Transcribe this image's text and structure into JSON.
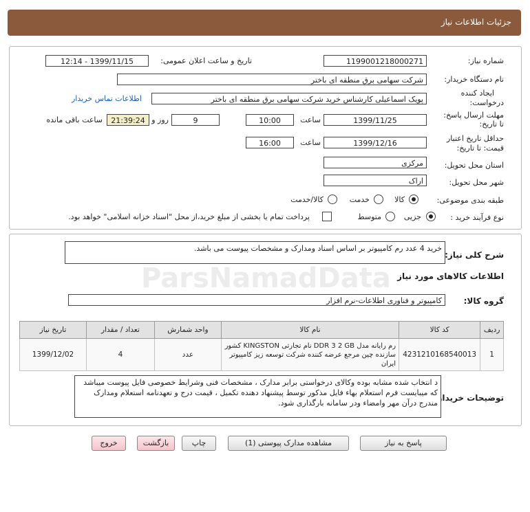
{
  "header": {
    "title": "جزئیات اطلاعات نیاز"
  },
  "fields": {
    "need_number_label": "شماره نیاز:",
    "need_number": "1199001218000271",
    "announce_label": "تاریخ و ساعت اعلان عمومی:",
    "announce_value": "1399/11/15 - 12:14",
    "buyer_org_label": "نام دستگاه خریدار:",
    "buyer_org": "شرکت سهامی برق منطقه ای باختر",
    "creator_label_1": "ایجاد کننده",
    "creator_label_2": "درخواست:",
    "creator": "پویک اسماعیلی کارشناس خرید شرکت سهامی برق منطقه ای باختر",
    "contact_link": "اطلاعات تماس خریدار",
    "deadline_label_1": "مهلت ارسال پاسخ:",
    "deadline_label_2": "تا تاریخ:",
    "deadline_date": "1399/11/25",
    "time_label": "ساعت",
    "deadline_time": "10:00",
    "days_value": "9",
    "days_label": "روز و",
    "remaining_time": "21:39:24",
    "remaining_label": "ساعت باقی مانده",
    "validity_label_1": "حداقل تاریخ اعتبار",
    "validity_label_2": "قیمت: تا تاریخ:",
    "validity_date": "1399/12/16",
    "validity_time": "16:00",
    "province_label": "استان محل تحویل:",
    "province": "مرکزی",
    "city_label": "شهر محل تحویل:",
    "city": "اراک",
    "category_label": "طبقه بندی موضوعی:",
    "category_options": [
      "کالا",
      "خدمت",
      "کالا/خدمت"
    ],
    "process_label": "نوع فرآیند خرید :",
    "process_options": [
      "جزیی",
      "متوسط"
    ],
    "payment_note": "پرداخت تمام یا بخشی از مبلغ خرید،از محل \"اسناد خزانه اسلامی\" خواهد بود."
  },
  "summary": {
    "label": "شرح کلی نیاز:",
    "text": "خرید 4 عدد رم کامپیوتر بر اساس اسناد ومدارک و مشخصات پیوست می باشد."
  },
  "goods": {
    "section_title": "اطلاعات کالاهای مورد نیاز",
    "group_label": "گروه کالا:",
    "group_value": "کامپیوتر و فناوری اطلاعات-نرم افزار",
    "columns": [
      "ردیف",
      "کد کالا",
      "نام کالا",
      "واحد شمارش",
      "تعداد / مقدار",
      "تاریخ نیاز"
    ],
    "rows": [
      {
        "index": "1",
        "code": "4231210168540013",
        "name": "رم رایانه مدل DDR 3 2 GB نام تجارتی KINGSTON کشور سازنده چین مرجع عرضه کننده شرکت توسعه زیز کامپیوتر ایران",
        "unit": "عدد",
        "qty": "4",
        "date": "1399/12/02"
      }
    ]
  },
  "notes": {
    "label": "توضیحات خریدار:",
    "text": "د انتخاب شده مشابه بوده وکالای درخواستی برابر مدارک ، مشخصات فنی وشرایط خصوصی فایل پیوست میباشد که میبایست فرم استعلام بهاء فایل مذکور توسط پیشنهاد دهنده تکمیل ، قیمت درج و تعهدنامه استعلام ومدارک مندرج درآن مهر وامضاء ودر سامانه بارگذاری شود."
  },
  "buttons": {
    "reply": "پاسخ به نیاز",
    "attachments": "مشاهده مدارک پیوستی (1)",
    "print": "چاپ",
    "back": "بازگشت",
    "exit": "خروج"
  },
  "watermark": {
    "text": "ParsNamadData"
  }
}
